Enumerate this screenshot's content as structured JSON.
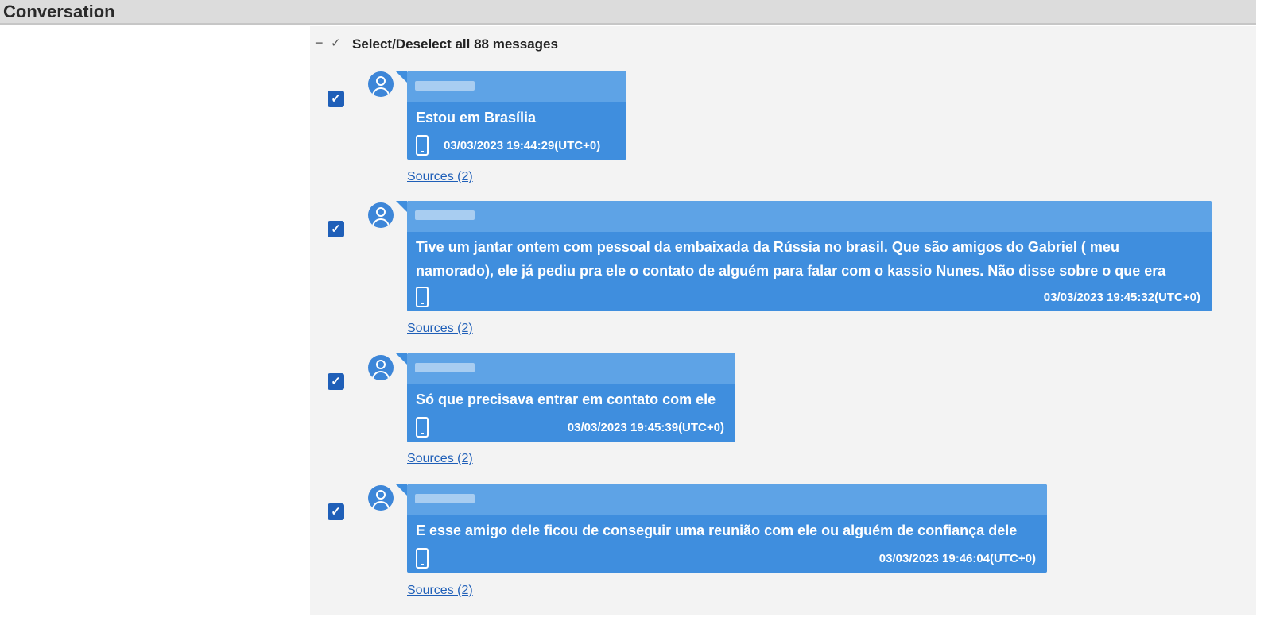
{
  "window": {
    "title": "Conversation"
  },
  "select_all": {
    "collapse_icon": "minus-icon",
    "check_icon": "check-icon",
    "label": "Select/Deselect all 88 messages"
  },
  "messages": [
    {
      "text": "Estou em Brasília",
      "timestamp": "03/03/2023 19:44:29(UTC+0)",
      "sources": "Sources (2)",
      "checked": true
    },
    {
      "text": "Tive um jantar ontem com pessoal da embaixada da Rússia no brasil. Que são amigos do Gabriel ( meu namorado), ele já pediu pra ele o contato de alguém para falar com o kassio Nunes. Não disse sobre o que era",
      "timestamp": "03/03/2023 19:45:32(UTC+0)",
      "sources": "Sources (2)",
      "checked": true
    },
    {
      "text": "Só que precisava entrar em contato com ele",
      "timestamp": "03/03/2023 19:45:39(UTC+0)",
      "sources": "Sources (2)",
      "checked": true
    },
    {
      "text": "E esse amigo dele ficou de conseguir uma reunião com ele ou alguém de confiança dele",
      "timestamp": "03/03/2023 19:46:04(UTC+0)",
      "sources": "Sources (2)",
      "checked": true
    }
  ],
  "colors": {
    "bubble": "#3f8ede",
    "bubble_header": "#5ea3e6",
    "checkbox": "#1f5fb8",
    "link": "#1f5fb8",
    "panel_bg": "#f3f3f3"
  }
}
